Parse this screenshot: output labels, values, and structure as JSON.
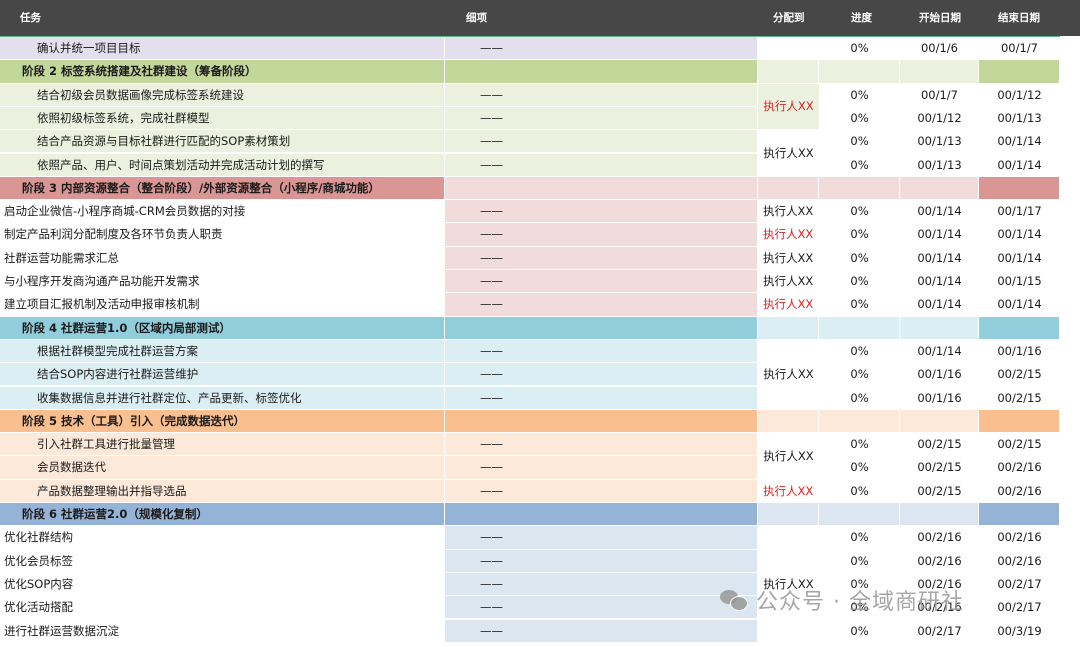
{
  "header": {
    "task": "任务",
    "detail": "细项",
    "assignee": "分配到",
    "progress": "进度",
    "start": "开始日期",
    "end": "结束日期"
  },
  "colors": {
    "header_bg": "#474747",
    "header_line": "#5fb48a",
    "phase2": "#c4d79b",
    "phase3": "#da9694",
    "phase4": "#92cddc",
    "phase5": "#fabf8f",
    "phase6": "#95b3d7",
    "row1": "#e4dfec",
    "tint2": "#ebf1de",
    "tint3": "#f2dcdb",
    "tint4": "#daeef3",
    "tint5": "#fde9d9",
    "tint6": "#dce6f1",
    "red_text": "#e02020"
  },
  "rows": [
    {
      "kind": "task",
      "task": "确认并统一项目目标",
      "detail": "——",
      "progress": "0%",
      "start": "00/1/6",
      "end": "00/1/7"
    },
    {
      "kind": "phase",
      "label": "阶段 2 标签系统搭建及社群建设（筹备阶段）"
    },
    {
      "kind": "task",
      "task": "结合初级会员数据画像完成标签系统建设",
      "detail": "——",
      "progress": "0%",
      "start": "00/1/7",
      "end": "00/1/12"
    },
    {
      "kind": "task",
      "task": "依照初级标签系统，完成社群模型",
      "detail": "——",
      "progress": "0%",
      "start": "00/1/12",
      "end": "00/1/13"
    },
    {
      "kind": "task",
      "task": "结合产品资源与目标社群进行匹配的SOP素材策划",
      "detail": "——",
      "progress": "0%",
      "start": "00/1/13",
      "end": "00/1/14"
    },
    {
      "kind": "task",
      "task": "依照产品、用户、时间点策划活动并完成活动计划的撰写",
      "detail": "——",
      "progress": "0%",
      "start": "00/1/13",
      "end": "00/1/14"
    },
    {
      "kind": "phase",
      "label": "阶段 3 内部资源整合（整合阶段）/外部资源整合（小程序/商城功能）"
    },
    {
      "kind": "task",
      "task": "启动企业微信-小程序商城-CRM会员数据的对接",
      "detail": "——",
      "assignee": "执行人XX",
      "progress": "0%",
      "start": "00/1/14",
      "end": "00/1/17"
    },
    {
      "kind": "task",
      "task": "制定产品利润分配制度及各环节负责人职责",
      "detail": "——",
      "assignee": "执行人XX",
      "progress": "0%",
      "start": "00/1/14",
      "end": "00/1/14"
    },
    {
      "kind": "task",
      "task": "社群运营功能需求汇总",
      "detail": "——",
      "assignee": "执行人XX",
      "progress": "0%",
      "start": "00/1/14",
      "end": "00/1/14"
    },
    {
      "kind": "task",
      "task": "与小程序开发商沟通产品功能开发需求",
      "detail": "——",
      "assignee": "执行人XX",
      "progress": "0%",
      "start": "00/1/14",
      "end": "00/1/15"
    },
    {
      "kind": "task",
      "task": "建立项目汇报机制及活动申报审核机制",
      "detail": "——",
      "assignee": "执行人XX",
      "progress": "0%",
      "start": "00/1/14",
      "end": "00/1/14"
    },
    {
      "kind": "phase",
      "label": "阶段 4 社群运营1.0（区域内局部测试）"
    },
    {
      "kind": "task",
      "task": "根据社群模型完成社群运营方案",
      "detail": "——",
      "progress": "0%",
      "start": "00/1/14",
      "end": "00/1/16"
    },
    {
      "kind": "task",
      "task": "结合SOP内容进行社群运营维护",
      "detail": "——",
      "progress": "0%",
      "start": "00/1/16",
      "end": "00/2/15"
    },
    {
      "kind": "task",
      "task": "收集数据信息并进行社群定位、产品更新、标签优化",
      "detail": "——",
      "progress": "0%",
      "start": "00/1/16",
      "end": "00/2/15"
    },
    {
      "kind": "phase",
      "label": "阶段 5 技术（工具）引入（完成数据迭代）"
    },
    {
      "kind": "task",
      "task": "引入社群工具进行批量管理",
      "detail": "——",
      "progress": "0%",
      "start": "00/2/15",
      "end": "00/2/15"
    },
    {
      "kind": "task",
      "task": "会员数据迭代",
      "detail": "——",
      "progress": "0%",
      "start": "00/2/15",
      "end": "00/2/16"
    },
    {
      "kind": "task",
      "task": "产品数据整理输出并指导选品",
      "detail": "——",
      "assignee": "执行人XX",
      "progress": "0%",
      "start": "00/2/15",
      "end": "00/2/16"
    },
    {
      "kind": "phase",
      "label": "阶段 6 社群运营2.0（规模化复制）"
    },
    {
      "kind": "task",
      "task": "优化社群结构",
      "detail": "——",
      "progress": "0%",
      "start": "00/2/16",
      "end": "00/2/16"
    },
    {
      "kind": "task",
      "task": "优化会员标签",
      "detail": "——",
      "progress": "0%",
      "start": "00/2/16",
      "end": "00/2/16"
    },
    {
      "kind": "task",
      "task": "优化SOP内容",
      "detail": "——",
      "progress": "0%",
      "start": "00/2/16",
      "end": "00/2/17"
    },
    {
      "kind": "task",
      "task": "优化活动搭配",
      "detail": "——",
      "progress": "0%",
      "start": "00/2/16",
      "end": "00/2/17"
    },
    {
      "kind": "task",
      "task": "进行社群运营数据沉淀",
      "detail": "——",
      "progress": "0%",
      "start": "00/2/17",
      "end": "00/3/19"
    }
  ],
  "merged_assignees": [
    {
      "label": "执行人XX",
      "color": "red"
    },
    {
      "label": "执行人XX",
      "color": "normal"
    },
    {
      "label": "执行人XX",
      "color": "normal"
    },
    {
      "label": "执行人XX",
      "color": "normal"
    },
    {
      "label": "执行人XX",
      "color": "normal"
    }
  ],
  "watermark": "公众号 · 全域商研社"
}
